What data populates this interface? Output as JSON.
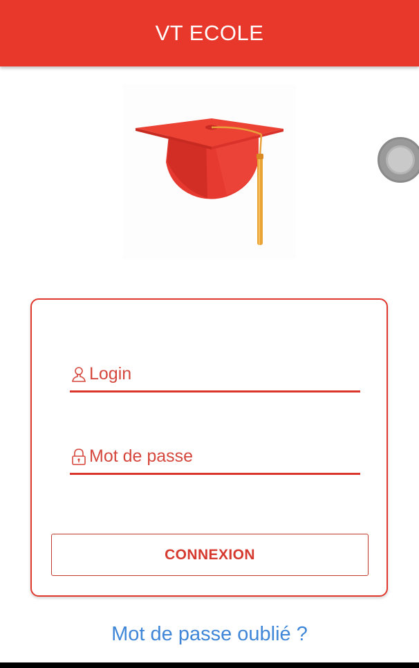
{
  "app": {
    "title": "VT ECOLE"
  },
  "logo": {
    "icon": "graduation-cap-icon"
  },
  "form": {
    "login_placeholder": "Login",
    "login_icon": "user-icon",
    "password_placeholder": "Mot de passe",
    "password_icon": "lock-icon",
    "submit_label": "CONNEXION"
  },
  "links": {
    "forgot_password": "Mot de passe oublié ?"
  },
  "colors": {
    "primary": "#e8382c",
    "accent_text": "#d5473c",
    "link": "#3f86d8",
    "background": "#ffffff"
  }
}
